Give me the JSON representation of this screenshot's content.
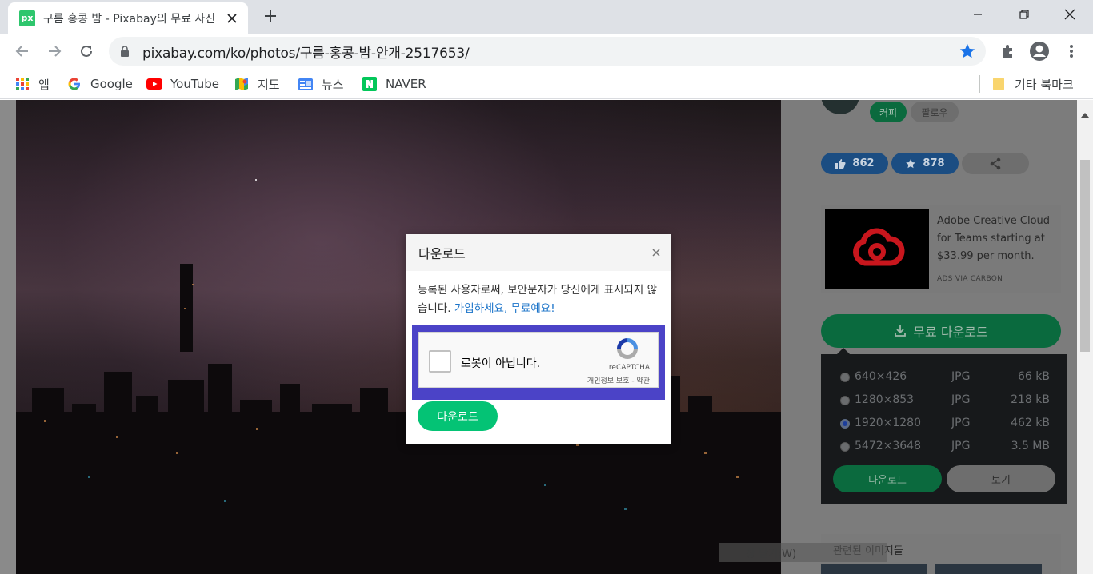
{
  "browser": {
    "tab": {
      "favicon": "px",
      "title": "구름 홍콩 밤 - Pixabay의 무료 사진"
    },
    "url": "pixabay.com/ko/photos/구름-홍콩-밤-안개-2517653/",
    "bookmarks": [
      {
        "label": "앱",
        "icon": "apps-grid-icon"
      },
      {
        "label": "Google",
        "icon": "google-icon"
      },
      {
        "label": "YouTube",
        "icon": "youtube-icon"
      },
      {
        "label": "지도",
        "icon": "maps-icon"
      },
      {
        "label": "뉴스",
        "icon": "news-icon"
      },
      {
        "label": "NAVER",
        "icon": "naver-icon"
      }
    ],
    "other_bookmarks": "기타 북마크"
  },
  "sidebar": {
    "coffee_chip": "커피",
    "follow_chip": "팔로우",
    "likes": "862",
    "favorites": "878",
    "ad": {
      "text": "Adobe Creative Cloud for Teams starting at $33.99 per month.",
      "via": "ADS VIA CARBON"
    },
    "free_download": "무료 다운로드",
    "download_options": [
      {
        "resolution": "640×426",
        "format": "JPG",
        "size": "66 kB",
        "selected": false
      },
      {
        "resolution": "1280×853",
        "format": "JPG",
        "size": "218 kB",
        "selected": false
      },
      {
        "resolution": "1920×1280",
        "format": "JPG",
        "size": "462 kB",
        "selected": true
      },
      {
        "resolution": "5472×3648",
        "format": "JPG",
        "size": "3.5 MB",
        "selected": false
      }
    ],
    "dropdown_download": "다운로드",
    "dropdown_view": "보기",
    "related_title": "관련된 이미지들"
  },
  "watermark": "창 닫기(W)",
  "modal": {
    "title": "다운로드",
    "message": "등록된 사용자로써, 보안문자가 당신에게 표시되지 않습니다.",
    "signup_link": "가입하세요, 무료예요!",
    "captcha_label": "로봇이 아닙니다.",
    "captcha_brand": "reCAPTCHA",
    "captcha_links": "개인정보 보호 - 약관",
    "download_button": "다운로드"
  },
  "colors": {
    "accent_green": "#04c375",
    "link_blue": "#1a73c9",
    "captcha_highlight": "#4b43c7"
  }
}
